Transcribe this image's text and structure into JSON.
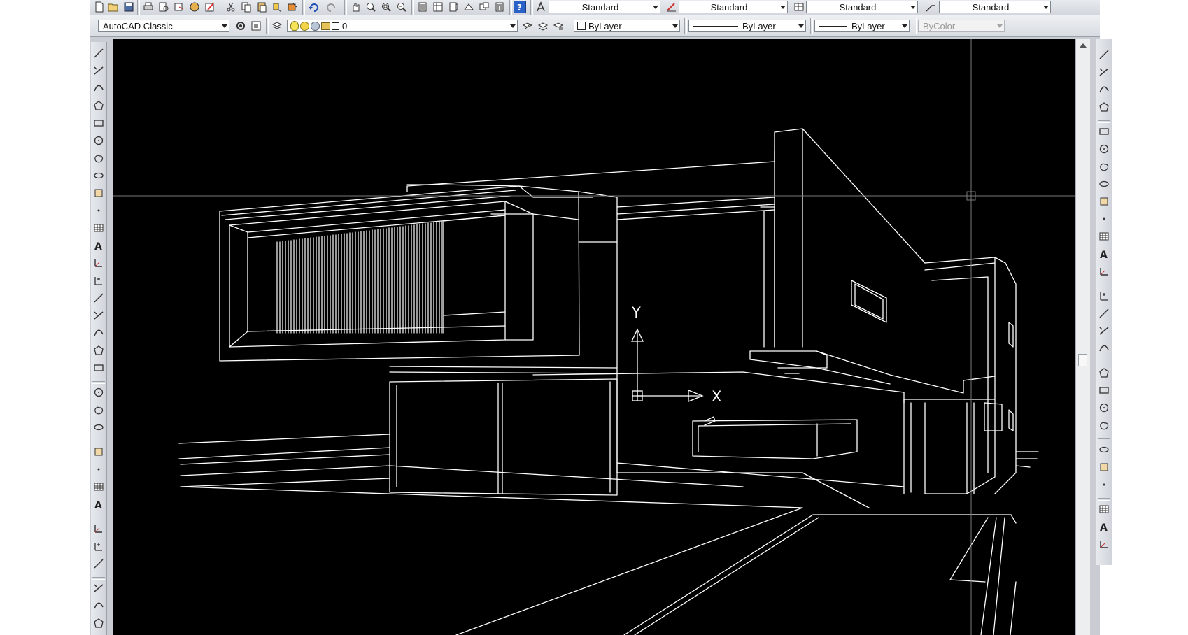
{
  "styles_toolbar": {
    "text_style": "Standard",
    "dim_style": "Standard",
    "table_style": "Standard",
    "multileader_style": "Standard"
  },
  "workspace": {
    "current": "AutoCAD Classic"
  },
  "layers": {
    "current_layer": "0"
  },
  "properties": {
    "color": "ByLayer",
    "linetype": "ByLayer",
    "lineweight": "ByLayer",
    "plot_style": "ByColor"
  },
  "ucs": {
    "x_label": "X",
    "y_label": "Y"
  },
  "colors": {
    "canvas": "#000000",
    "lines": "#ffffff",
    "crosshair": "#7a7a7a",
    "toolbar": "#d8dce1",
    "help_icon": "#2b62c7"
  },
  "icons": {
    "standard_toolbar": [
      "new-icon",
      "open-icon",
      "save-icon",
      "plot-icon",
      "plot-preview-icon",
      "publish-icon",
      "3d-dwf-icon",
      "markup-icon",
      "cut-icon",
      "copy-icon",
      "paste-icon",
      "match-properties-icon",
      "block-editor-icon",
      "undo-icon",
      "redo-icon",
      "pan-icon",
      "zoom-realtime-icon",
      "zoom-window-icon",
      "zoom-previous-icon",
      "properties-icon",
      "design-center-icon",
      "tool-palettes-icon",
      "sheet-set-icon",
      "markup-manager-icon",
      "quickcalc-icon",
      "help-icon"
    ],
    "draw_toolbar": [
      "line-icon",
      "construction-line-icon",
      "polyline-icon",
      "polygon-icon",
      "rectangle-icon",
      "arc-icon",
      "circle-icon",
      "revision-cloud-icon",
      "spline-icon",
      "ellipse-icon",
      "ellipse-arc-icon",
      "insert-block-icon",
      "make-block-icon",
      "point-icon",
      "hatch-icon",
      "gradient-icon",
      "region-icon",
      "table-icon",
      "multiline-text-icon"
    ],
    "ucs_toolbar": [
      "ucs-icon",
      "world-ucs-icon",
      "ucs-previous-icon",
      "face-ucs-icon",
      "object-ucs-icon",
      "view-ucs-icon",
      "origin-ucs-icon",
      "z-axis-ucs-icon",
      "3point-ucs-icon",
      "x-rotate-ucs-icon",
      "y-rotate-ucs-icon",
      "z-rotate-ucs-icon",
      "apply-ucs-icon"
    ],
    "dimension_toolbar": [
      "linear-dim-icon",
      "aligned-dim-icon",
      "arc-length-icon",
      "ordinate-icon",
      "radius-icon",
      "jogged-icon",
      "diameter-icon",
      "angular-icon",
      "quick-dim-icon",
      "baseline-icon",
      "continue-icon",
      "dim-space-icon",
      "dim-break-icon",
      "tolerance-icon",
      "center-mark-icon",
      "inspection-icon",
      "jogged-linear-icon",
      "dimedit-icon",
      "dimtedit-icon",
      "dim-update-icon",
      "dim-style-icon"
    ],
    "multileader_toolbar": [
      "multileader-icon",
      "add-leader-icon",
      "remove-leader-icon",
      "mleader-align-icon",
      "mleader-collect-icon",
      "mleader-style-icon"
    ]
  }
}
